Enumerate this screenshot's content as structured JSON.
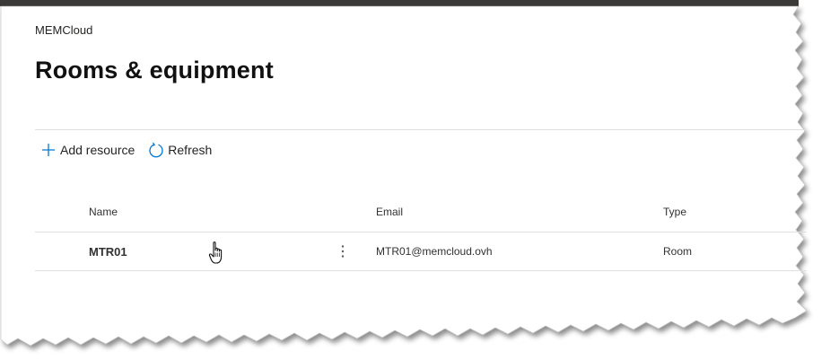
{
  "header": {
    "org_name": "MEMCloud",
    "page_title": "Rooms & equipment"
  },
  "toolbar": {
    "add_resource_label": "Add resource",
    "refresh_label": "Refresh",
    "add_icon": "plus-icon",
    "refresh_icon": "refresh-icon"
  },
  "table": {
    "columns": [
      "Name",
      "Email",
      "Type"
    ],
    "rows": [
      {
        "name": "MTR01",
        "email": "MTR01@memcloud.ovh",
        "type": "Room"
      }
    ]
  },
  "colors": {
    "accent": "#0078d4",
    "text": "#252423",
    "divider": "#e1dfdd"
  }
}
